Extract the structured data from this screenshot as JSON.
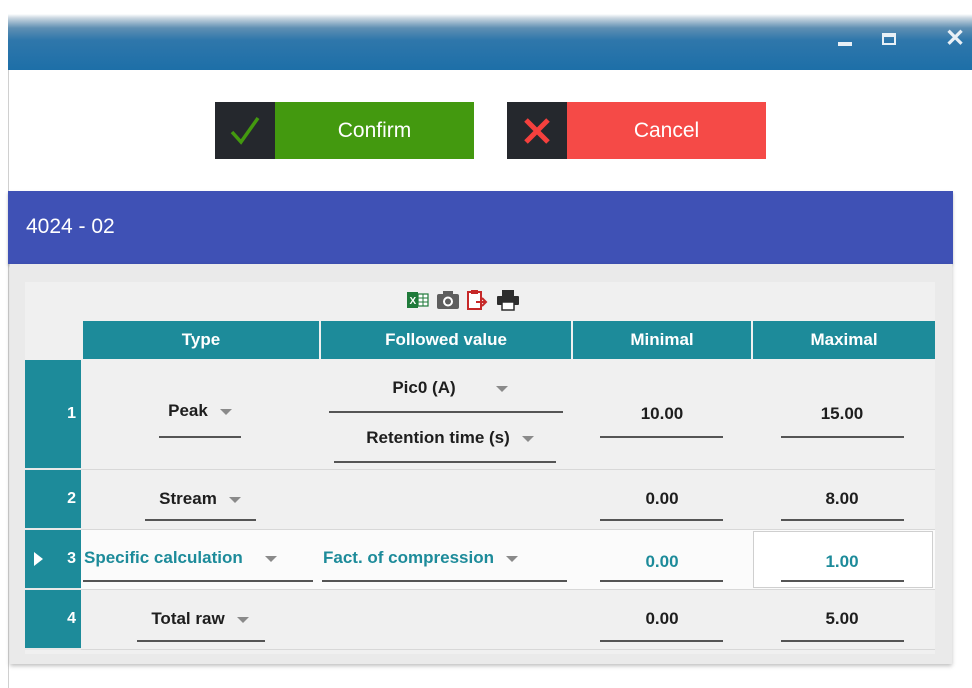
{
  "window": {
    "minimize_icon": "minimize-icon",
    "maximize_icon": "maximize-icon",
    "close_icon": "close-icon",
    "close_glyph": "✕"
  },
  "actions": {
    "confirm": {
      "label": "Confirm",
      "icon": "checkmark-icon",
      "color": "#43990f"
    },
    "cancel": {
      "label": "Cancel",
      "icon": "x-icon",
      "color": "#f54a47"
    }
  },
  "panel": {
    "title": "4024 - 02",
    "color": "#3f51b5"
  },
  "toolbar": {
    "icons": [
      "excel-export-icon",
      "camera-icon",
      "clipboard-export-icon",
      "print-icon"
    ]
  },
  "table": {
    "header_color": "#1d8b9a",
    "columns": [
      "Type",
      "Followed value",
      "Minimal",
      "Maximal"
    ],
    "rows": [
      {
        "num": "1",
        "type": "Peak",
        "followed_value_1": "Pic0 (A)",
        "followed_value_2": "Retention time (s)",
        "minimal": "10.00",
        "maximal": "15.00"
      },
      {
        "num": "2",
        "type": "Stream",
        "followed_value_1": "",
        "followed_value_2": "",
        "minimal": "0.00",
        "maximal": "8.00"
      },
      {
        "num": "3",
        "type": "Specific calculation",
        "followed_value_1": "Fact. of compression",
        "followed_value_2": "",
        "minimal": "0.00",
        "maximal": "1.00",
        "selected": true
      },
      {
        "num": "4",
        "type": "Total raw",
        "followed_value_1": "",
        "followed_value_2": "",
        "minimal": "0.00",
        "maximal": "5.00"
      }
    ]
  }
}
